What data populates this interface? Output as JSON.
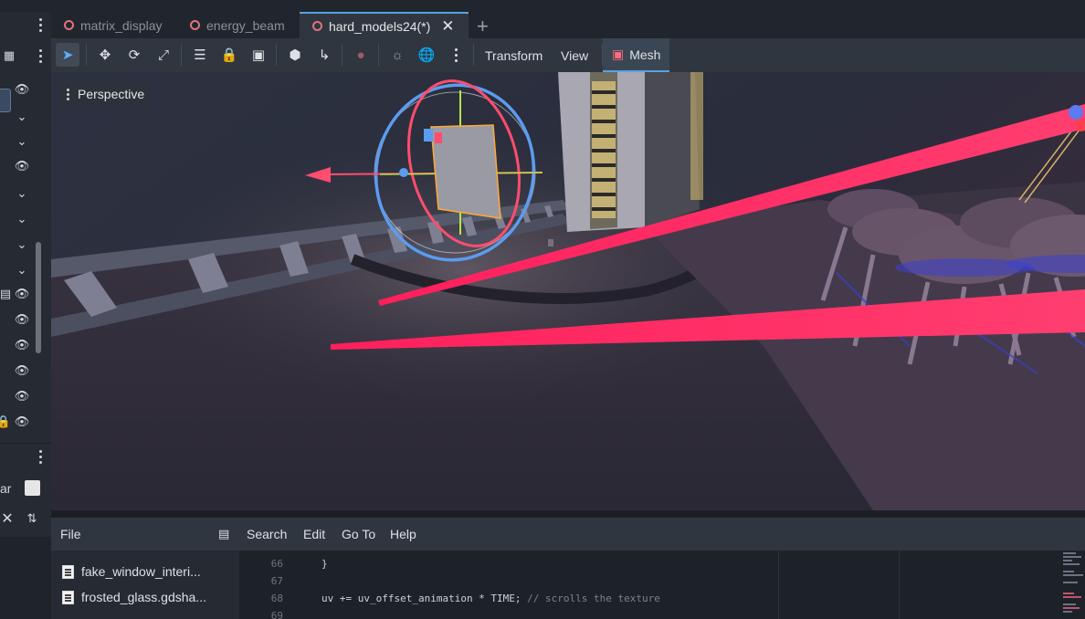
{
  "tabs": [
    {
      "label": "matrix_display",
      "active": false
    },
    {
      "label": "energy_beam",
      "active": false
    },
    {
      "label": "hard_models24(*)",
      "active": true
    }
  ],
  "toolbar": {
    "transform_label": "Transform",
    "view_label": "View",
    "mesh_label": "Mesh"
  },
  "viewport": {
    "perspective_label": "Perspective"
  },
  "left_dock": {
    "partial_text": "ar"
  },
  "script_editor": {
    "menu": {
      "file": "File",
      "search": "Search",
      "edit": "Edit",
      "goto": "Go To",
      "help": "Help"
    },
    "files": [
      {
        "name": "fake_window_interi..."
      },
      {
        "name": "frosted_glass.gdsha..."
      }
    ],
    "lines": [
      {
        "number": "66",
        "code": "}",
        "comment": ""
      },
      {
        "number": "67",
        "code": "",
        "comment": ""
      },
      {
        "number": "68",
        "code": "uv += uv_offset_animation * TIME; ",
        "comment": "// scrolls the texture"
      },
      {
        "number": "69",
        "code": "",
        "comment": ""
      }
    ]
  },
  "colors": {
    "accent": "#5aa2e0",
    "beam": "#ff2d6a",
    "tab_dot": "#e0737a",
    "gizmo_x": "#ff4d6d",
    "gizmo_y": "#b6e64a",
    "gizmo_z": "#5b9cf0"
  }
}
